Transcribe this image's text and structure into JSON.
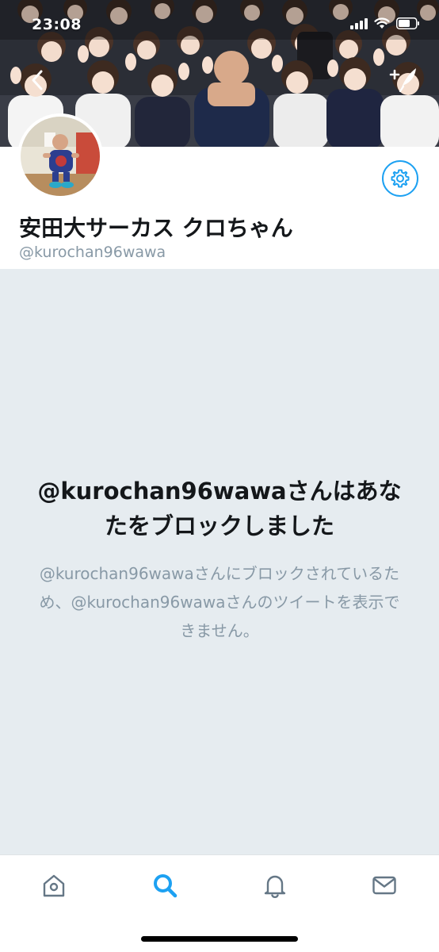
{
  "status_bar": {
    "time": "23:08"
  },
  "header": {
    "back_icon": "chevron-left-icon",
    "compose_icon": "compose-tweet-icon"
  },
  "profile": {
    "display_name": "安田大サーカス クロちゃん",
    "handle": "@kurochan96wawa",
    "settings_icon": "gear-icon"
  },
  "blocked": {
    "title": "@kurochan96wawaさんはあなたをブロックしました",
    "description": "@kurochan96wawaさんにブロックされているため、@kurochan96wawaさんのツイートを表示できません。"
  },
  "tab_bar": {
    "tabs": [
      {
        "name": "home",
        "icon": "home-icon",
        "active": false
      },
      {
        "name": "search",
        "icon": "search-icon",
        "active": true
      },
      {
        "name": "notifications",
        "icon": "bell-icon",
        "active": false
      },
      {
        "name": "messages",
        "icon": "envelope-icon",
        "active": false
      }
    ]
  },
  "colors": {
    "accent": "#1da1f2",
    "background_gray": "#e6ecf0",
    "secondary_text": "#8899a6",
    "primary_text": "#14171a"
  }
}
